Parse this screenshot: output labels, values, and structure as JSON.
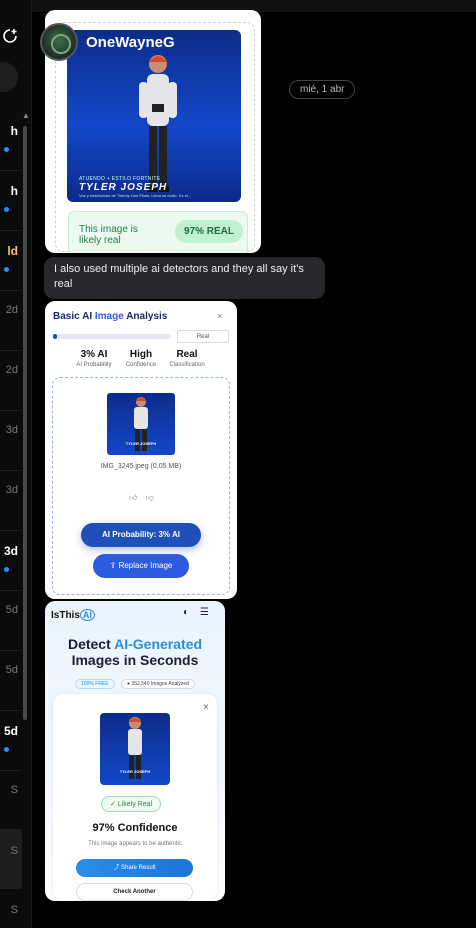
{
  "header": {
    "username": "OneWayneG"
  },
  "date_separator": "mié, 1 abr",
  "sidebar": {
    "items": [
      {
        "label": "h"
      },
      {
        "label": "h"
      },
      {
        "label": "ld"
      },
      {
        "label": "2d"
      },
      {
        "label": "2d"
      },
      {
        "label": "3d"
      },
      {
        "label": "3d"
      },
      {
        "label": "3d"
      },
      {
        "label": "5d"
      },
      {
        "label": "5d"
      },
      {
        "label": "5d"
      },
      {
        "label": "S"
      },
      {
        "label": "S"
      },
      {
        "label": "S"
      }
    ]
  },
  "message1": {
    "poster": {
      "small_caption": "ATUENDO + ESTILO FORTNITE",
      "name": "TYLER JOSEPH",
      "lines": "Voz y sintetizador de Twenty One Pilots. Lleva su estilo. Es el...",
      "person_colors": {
        "hair": "#d8482f",
        "jacket": "#e6e6ea"
      }
    },
    "result_text": "This image is likely real",
    "badge": "97% REAL"
  },
  "message2": {
    "text": "I also used multiple ai detectors and they all say it’s real"
  },
  "analysis_card": {
    "title_main": "Basic AI ",
    "title_accent": "Image",
    "title_end": " Analysis",
    "close": "×",
    "progress_percent": 3,
    "tag": "Real",
    "stats": [
      {
        "value": "3% AI",
        "label": "AI Probability"
      },
      {
        "value": "High",
        "label": "Confidence"
      },
      {
        "value": "Real",
        "label": "Classification"
      }
    ],
    "file_name": "IMG_3245.jpeg (0.05 MB)",
    "primary_button": "AI Probability: 3% AI",
    "secondary_button": "Replace Image",
    "accent_color": "#1f4fb8"
  },
  "isthisai_card": {
    "logo_text": "IsThis",
    "logo_ai": "AI",
    "headline_1": "Detect ",
    "headline_accent": "AI-Generated",
    "headline_2": "Images in Seconds",
    "chip_free": "100% FREE",
    "chip_count": "352,540 Images Analyzed",
    "close": "×",
    "likely": "Likely Real",
    "confidence": "97% Confidence",
    "sub": "This image appears to be authentic",
    "share_button": "Share Result",
    "check_button": "Check Another",
    "accent_color": "#2e8be6"
  }
}
